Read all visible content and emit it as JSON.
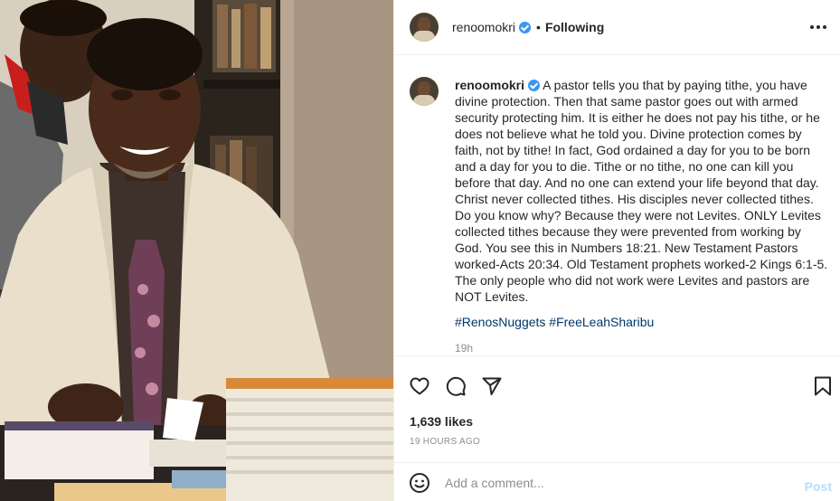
{
  "post": {
    "username": "renoomokri",
    "follow_status": "Following",
    "separator": "•",
    "caption": "A pastor tells you that by paying tithe, you have divine protection. Then that same pastor goes out with armed security protecting him. It is either he does not pay his tithe, or he does not believe what he told you. Divine protection comes by faith, not by tithe! In fact, God ordained a day for you to be born and a day for you to die. Tithe or no tithe, no one can kill you before that day. And no one can extend your life beyond that day. Christ never collected tithes. His disciples never collected tithes. Do you know why? Because they were not Levites. ONLY Levites collected tithes because they were prevented from working by God. You see this in Numbers 18:21. New Testament Pastors worked-Acts 20:34. Old Testament prophets worked-2 Kings 6:1-5. The only people who did not work were Levites and pastors are NOT Levites.",
    "hashtags": [
      "#RenosNuggets",
      "#FreeLeahSharibu"
    ],
    "relative_time": "19h",
    "likes": "1,639 likes",
    "date": "19 HOURS AGO"
  },
  "comment": {
    "placeholder": "Add a comment...",
    "post_label": "Post"
  },
  "icons": {
    "header": [
      "verified-badge-icon",
      "more-options-icon"
    ],
    "actions": [
      "heart-icon",
      "comment-icon",
      "share-icon",
      "bookmark-icon"
    ],
    "comment": [
      "emoji-icon"
    ]
  },
  "colors": {
    "verified": "#3897f0",
    "hashtag": "#00376b",
    "muted": "#8e8e8e",
    "post_button": "#b2dffc"
  }
}
